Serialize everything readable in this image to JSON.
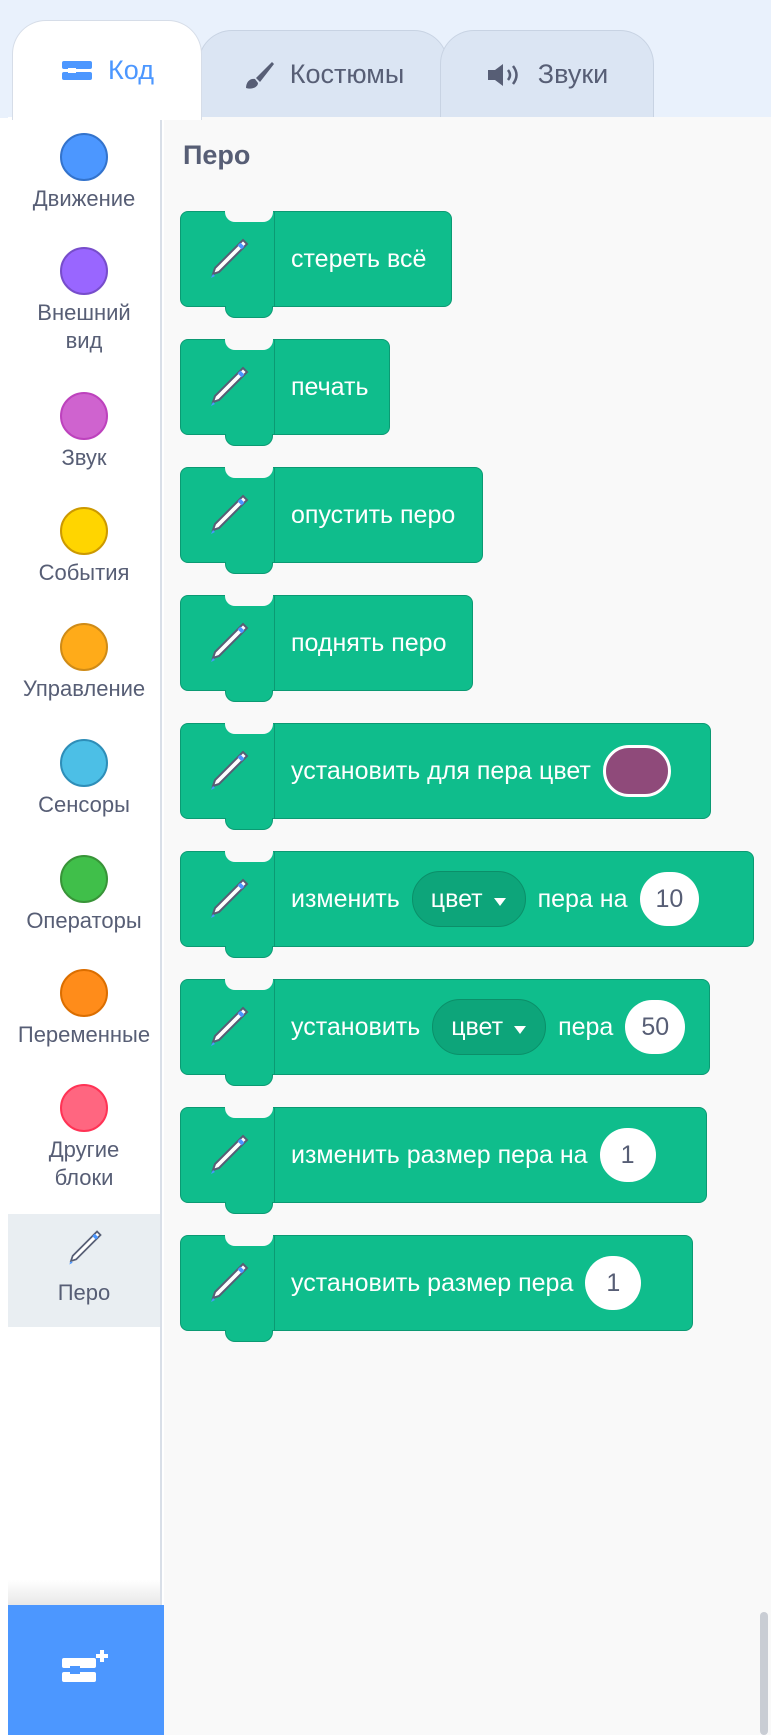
{
  "tabs": [
    {
      "label": "Код",
      "icon": "code-icon",
      "active": true
    },
    {
      "label": "Костюмы",
      "icon": "brush-icon",
      "active": false
    },
    {
      "label": "Звуки",
      "icon": "speaker-icon",
      "active": false
    }
  ],
  "categories": [
    {
      "label": "Движение",
      "color": "#4c97ff",
      "border": "#3373cc"
    },
    {
      "label": "Внешний\nвид",
      "color": "#9966ff",
      "border": "#774dcb"
    },
    {
      "label": "Звук",
      "color": "#cf63cf",
      "border": "#bd42bd"
    },
    {
      "label": "События",
      "color": "#ffd500",
      "border": "#cc9900"
    },
    {
      "label": "Управление",
      "color": "#ffab19",
      "border": "#cf8b17"
    },
    {
      "label": "Сенсоры",
      "color": "#4cbfe6",
      "border": "#2e8eb8"
    },
    {
      "label": "Операторы",
      "color": "#40bf4a",
      "border": "#389438"
    },
    {
      "label": "Переменные",
      "color": "#ff8c1a",
      "border": "#db6e00"
    },
    {
      "label": "Другие\nблоки",
      "color": "#ff6680",
      "border": "#ff3355"
    },
    {
      "label": "Перо",
      "icon": "pen-icon",
      "selected": true
    }
  ],
  "palette": {
    "section_title": "Перо",
    "blocks": [
      {
        "text": "стереть всё"
      },
      {
        "text": "печать"
      },
      {
        "text": "опустить перо"
      },
      {
        "text": "поднять перо"
      },
      {
        "text": "установить для пера цвет",
        "swatch": "#8f4a7a"
      },
      {
        "text": "изменить",
        "dropdown": "цвет",
        "text2": "пера на",
        "number": "10"
      },
      {
        "text": "установить",
        "dropdown": "цвет",
        "text2": "пера",
        "number": "50"
      },
      {
        "text": "изменить размер пера на",
        "number": "1"
      },
      {
        "text": "установить размер пера",
        "number": "1"
      }
    ]
  },
  "extension_button": {
    "icon": "add-extension-icon"
  }
}
